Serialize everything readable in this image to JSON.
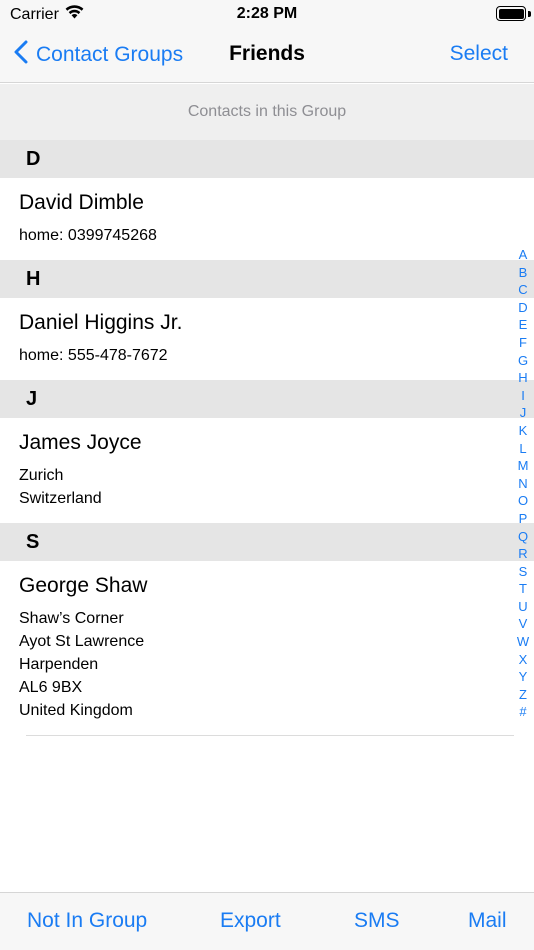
{
  "status_bar": {
    "carrier": "Carrier",
    "time": "2:28 PM"
  },
  "nav": {
    "back_label": "Contact Groups",
    "title": "Friends",
    "action_label": "Select"
  },
  "group_header": "Contacts in this Group",
  "sections": [
    {
      "letter": "D",
      "contacts": [
        {
          "name": "David Dimble",
          "lines": [
            "home: 0399745268"
          ]
        }
      ]
    },
    {
      "letter": "H",
      "contacts": [
        {
          "name": "Daniel Higgins Jr.",
          "lines": [
            "home: 555-478-7672"
          ]
        }
      ]
    },
    {
      "letter": "J",
      "contacts": [
        {
          "name": "James Joyce",
          "lines": [
            "Zurich",
            "Switzerland"
          ]
        }
      ]
    },
    {
      "letter": "S",
      "contacts": [
        {
          "name": "George Shaw",
          "lines": [
            "Shaw’s Corner",
            "Ayot St Lawrence",
            "Harpenden",
            "AL6 9BX",
            "United Kingdom"
          ]
        }
      ]
    }
  ],
  "section_index": [
    "A",
    "B",
    "C",
    "D",
    "E",
    "F",
    "G",
    "H",
    "I",
    "J",
    "K",
    "L",
    "M",
    "N",
    "O",
    "P",
    "Q",
    "R",
    "S",
    "T",
    "U",
    "V",
    "W",
    "X",
    "Y",
    "Z",
    "#"
  ],
  "toolbar": {
    "not_in_group": "Not In Group",
    "export": "Export",
    "sms": "SMS",
    "mail": "Mail"
  },
  "colors": {
    "accent": "#1a7cf3",
    "section_header_bg": "#e5e5e5",
    "group_header_bg": "#efefef"
  }
}
